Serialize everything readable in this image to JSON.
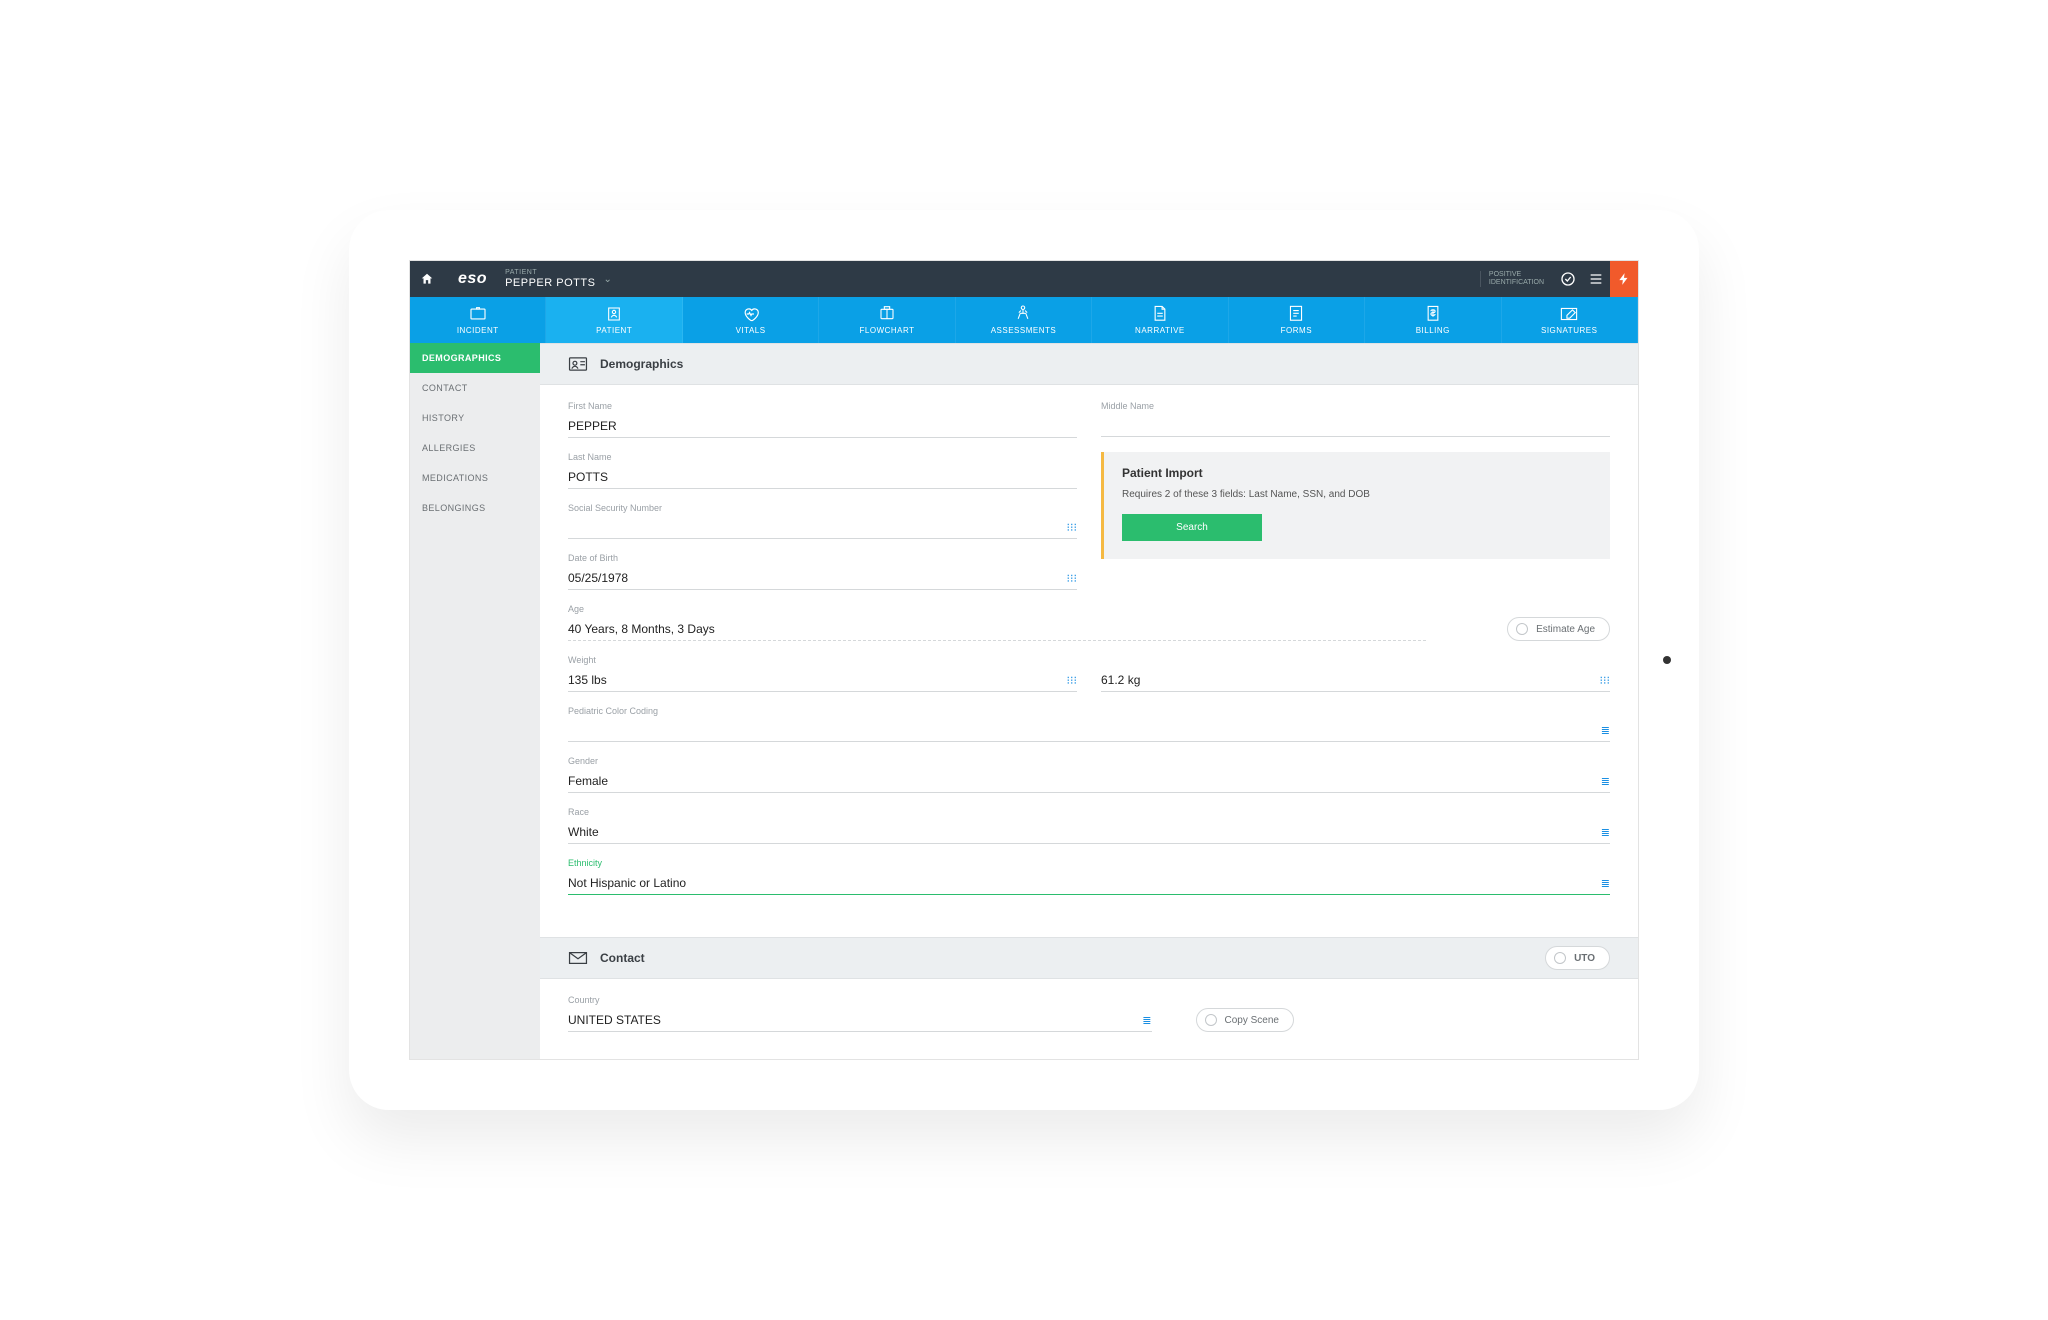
{
  "header": {
    "logo": "eso",
    "patient_label": "PATIENT",
    "patient_name": "PEPPER POTTS",
    "positive_id_line1": "POSITIVE",
    "positive_id_line2": "IDENTIFICATION"
  },
  "tabs": [
    {
      "label": "INCIDENT"
    },
    {
      "label": "PATIENT"
    },
    {
      "label": "VITALS"
    },
    {
      "label": "FLOWCHART"
    },
    {
      "label": "ASSESSMENTS"
    },
    {
      "label": "NARRATIVE"
    },
    {
      "label": "FORMS"
    },
    {
      "label": "BILLING"
    },
    {
      "label": "SIGNATURES"
    }
  ],
  "sidebar": [
    {
      "label": "DEMOGRAPHICS"
    },
    {
      "label": "CONTACT"
    },
    {
      "label": "HISTORY"
    },
    {
      "label": "ALLERGIES"
    },
    {
      "label": "MEDICATIONS"
    },
    {
      "label": "BELONGINGS"
    }
  ],
  "sections": {
    "demographics_title": "Demographics",
    "contact_title": "Contact"
  },
  "fields": {
    "first_name": {
      "label": "First Name",
      "value": "PEPPER"
    },
    "middle_name": {
      "label": "Middle Name",
      "value": ""
    },
    "last_name": {
      "label": "Last Name",
      "value": "POTTS"
    },
    "ssn": {
      "label": "Social Security Number",
      "value": ""
    },
    "dob": {
      "label": "Date of Birth",
      "value": "05/25/1978"
    },
    "age": {
      "label": "Age",
      "value": "40 Years, 8 Months, 3 Days"
    },
    "weight_lbs": {
      "label": "Weight",
      "value": "135 lbs"
    },
    "weight_kg": {
      "value": "61.2 kg"
    },
    "pediatric": {
      "label": "Pediatric Color Coding",
      "value": ""
    },
    "gender": {
      "label": "Gender",
      "value": "Female"
    },
    "race": {
      "label": "Race",
      "value": "White"
    },
    "ethnicity": {
      "label": "Ethnicity",
      "value": "Not Hispanic or Latino"
    },
    "country": {
      "label": "Country",
      "value": "UNITED STATES"
    }
  },
  "import": {
    "title": "Patient Import",
    "desc": "Requires 2 of these 3 fields: Last Name, SSN, and DOB",
    "button": "Search"
  },
  "buttons": {
    "estimate_age": "Estimate Age",
    "uto": "UTO",
    "copy_scene": "Copy Scene"
  }
}
